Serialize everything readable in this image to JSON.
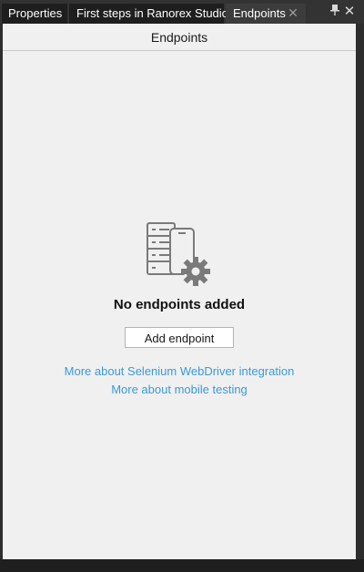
{
  "tabs": [
    {
      "label": "Properties"
    },
    {
      "label": "First steps in Ranorex Studio"
    },
    {
      "label": "Endpoints",
      "active": true
    }
  ],
  "window_controls": {
    "pin_icon": "pin-icon",
    "close_icon": "close-icon"
  },
  "panel": {
    "title": "Endpoints",
    "empty_state": {
      "icon": "devices-settings-icon",
      "message": "No endpoints added",
      "add_button_label": "Add endpoint",
      "link_selenium": "More about Selenium WebDriver integration",
      "link_mobile": "More about mobile testing"
    }
  },
  "colors": {
    "tab_bar": "#333333",
    "panel_background": "#f0f0f0",
    "link": "#3a9ad9",
    "icon": "#7a7a7a"
  }
}
